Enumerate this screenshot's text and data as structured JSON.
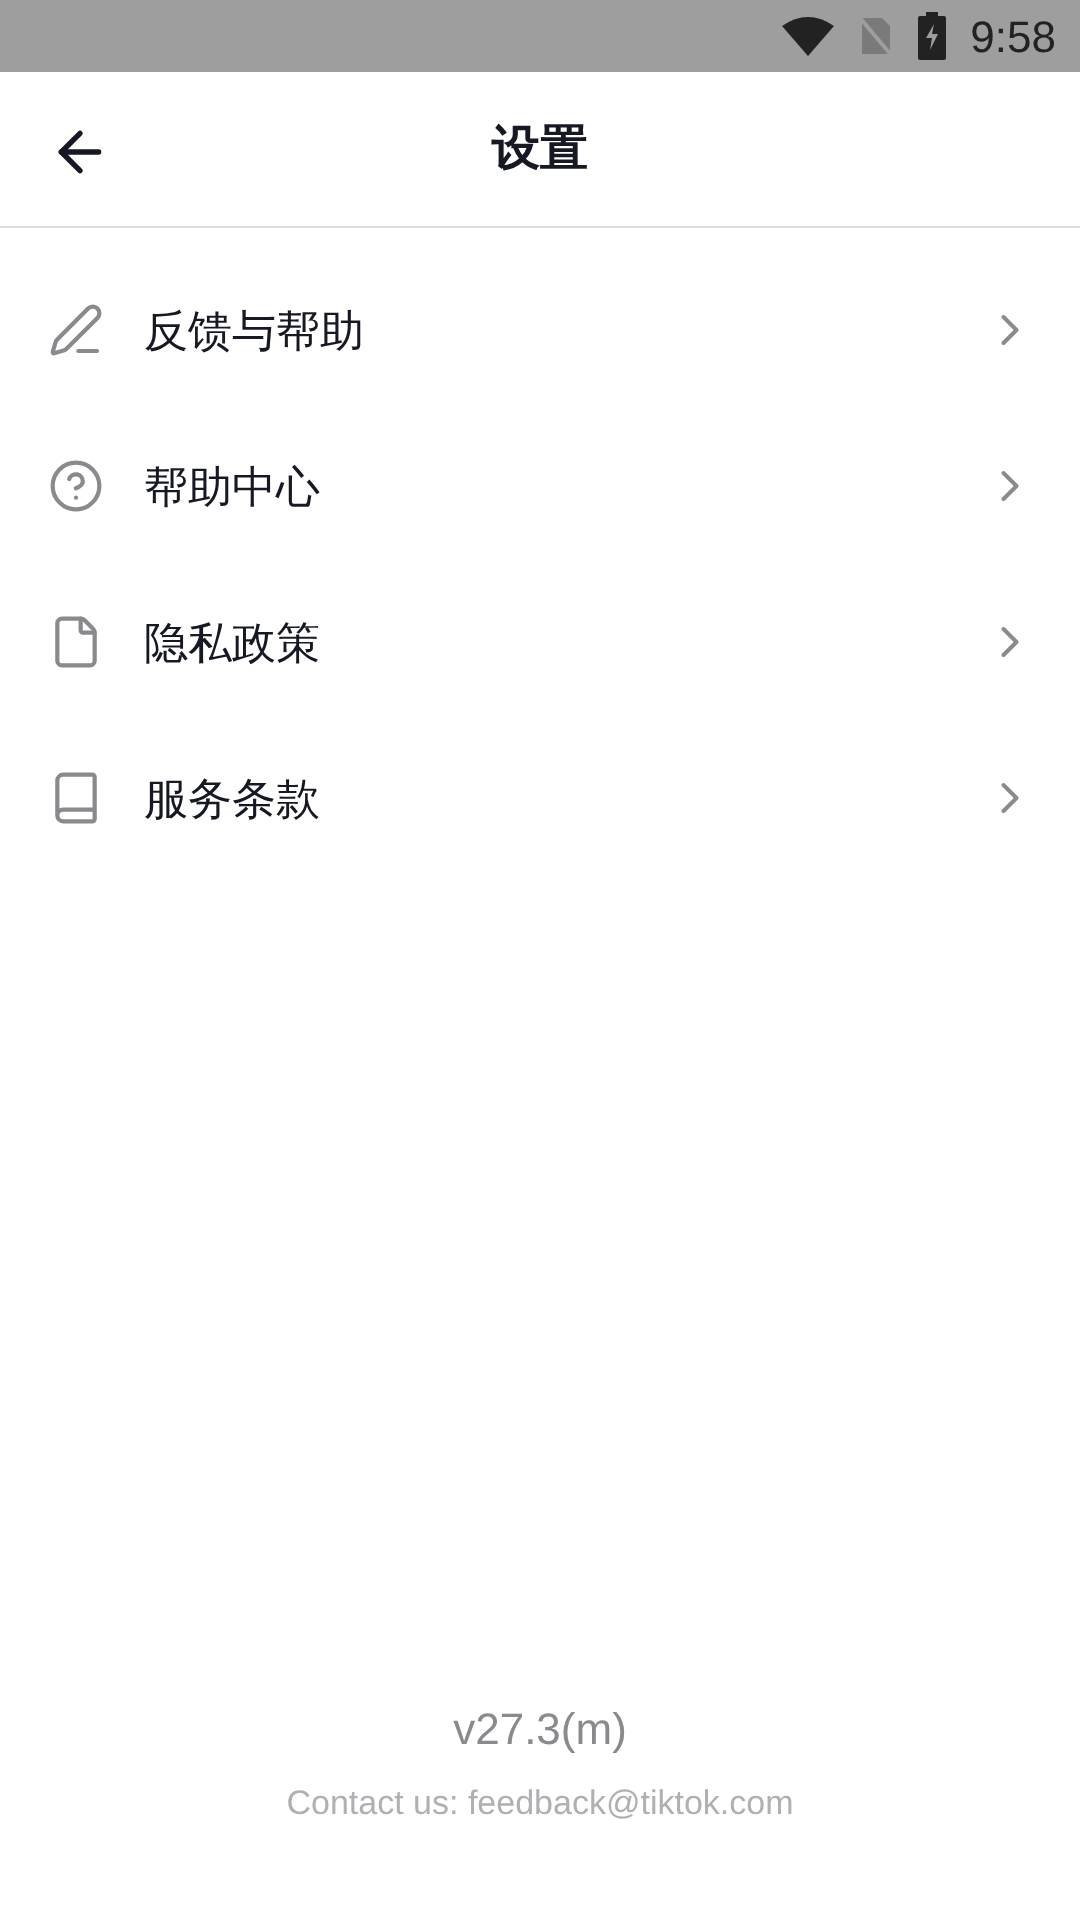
{
  "status_bar": {
    "time": "9:58"
  },
  "header": {
    "title": "设置"
  },
  "menu": [
    {
      "kind": "edit",
      "label": "反馈与帮助"
    },
    {
      "kind": "help",
      "label": "帮助中心"
    },
    {
      "kind": "file",
      "label": "隐私政策"
    },
    {
      "kind": "book",
      "label": "服务条款"
    }
  ],
  "footer": {
    "version": "v27.3(m)",
    "contact": "Contact us: feedback@tiktok.com"
  }
}
